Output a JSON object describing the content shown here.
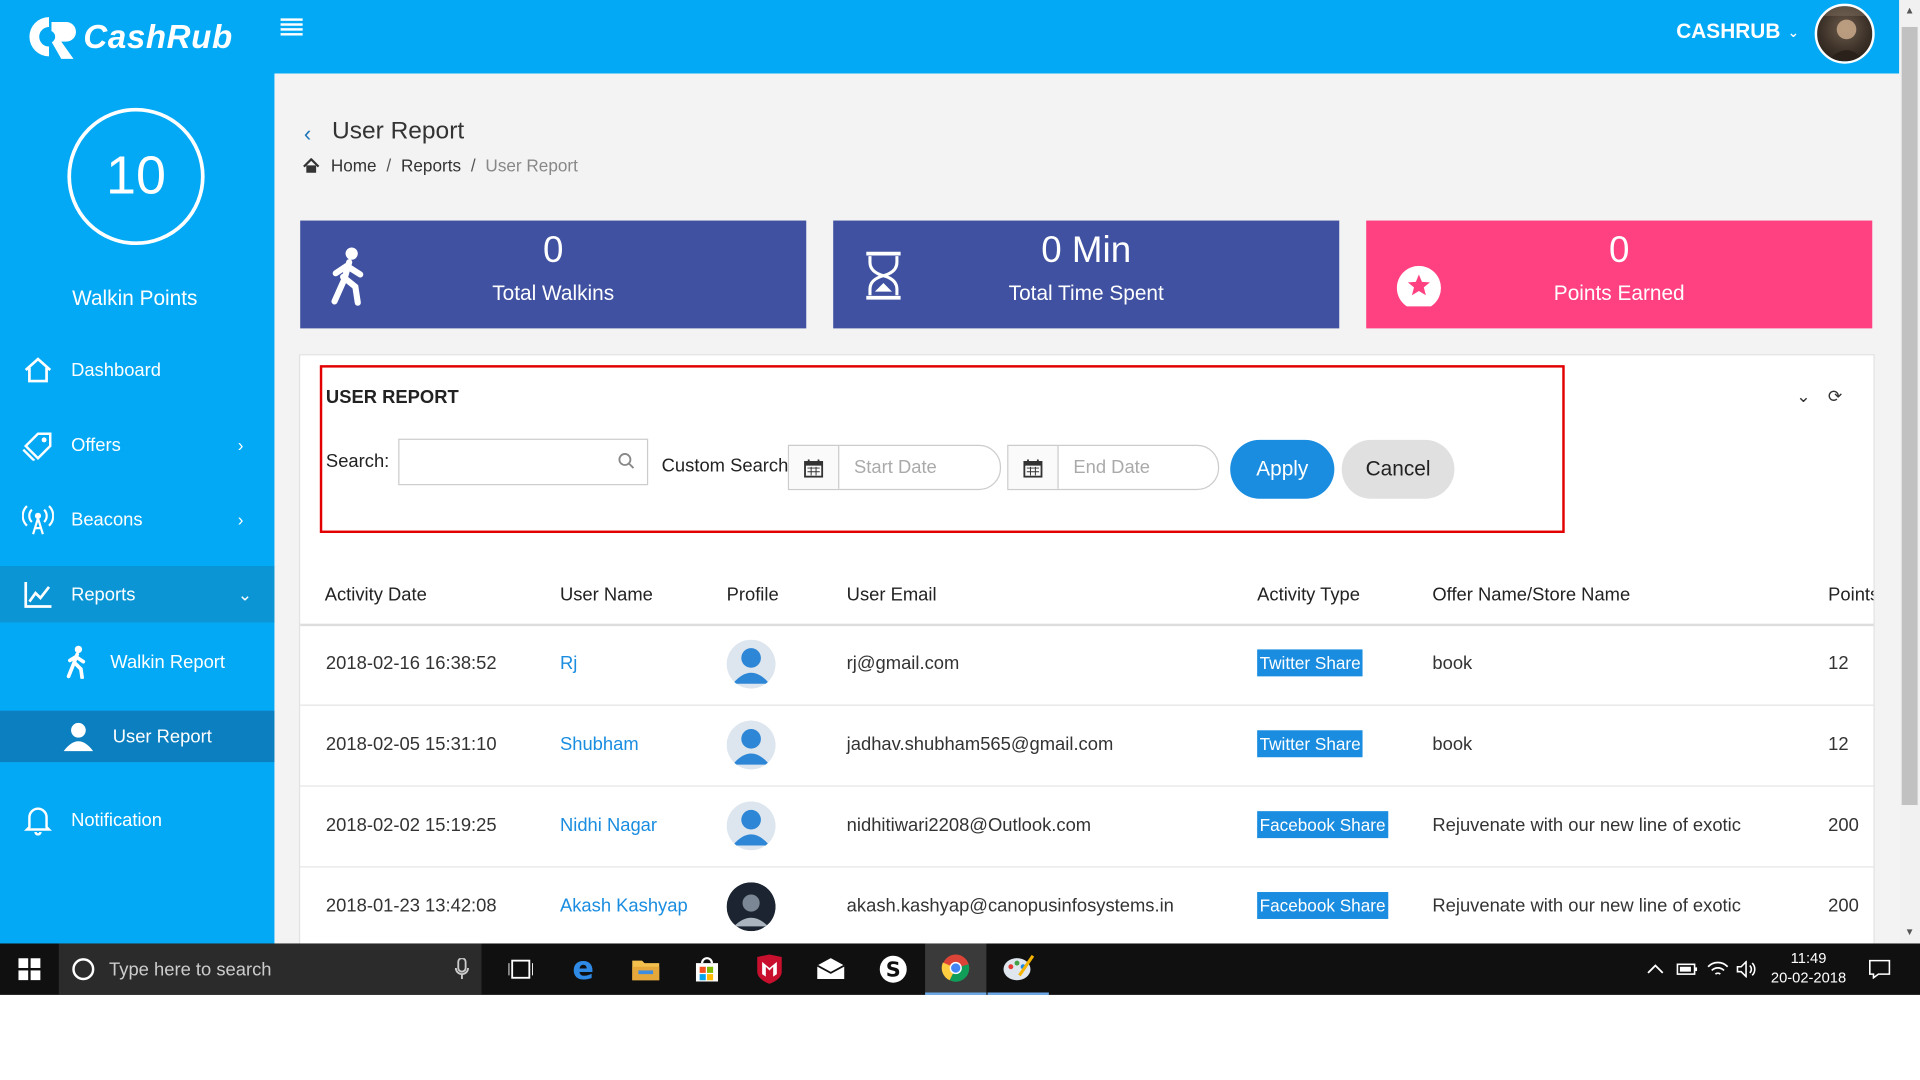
{
  "app": {
    "brand": "CashRub",
    "user_label": "CASHRUB"
  },
  "sidebar": {
    "points_value": "10",
    "points_label": "Walkin Points",
    "items": [
      {
        "label": "Dashboard"
      },
      {
        "label": "Offers"
      },
      {
        "label": "Beacons"
      },
      {
        "label": "Reports"
      },
      {
        "label": "Walkin Report"
      },
      {
        "label": "User Report"
      },
      {
        "label": "Notification"
      }
    ]
  },
  "page": {
    "title": "User Report",
    "breadcrumb": [
      "Home",
      "Reports",
      "User Report"
    ]
  },
  "stats": [
    {
      "value": "0",
      "caption": "Total Walkins",
      "color": "#3f51a0"
    },
    {
      "value": "0 Min",
      "caption": "Total Time Spent",
      "color": "#3f51a0"
    },
    {
      "value": "0",
      "caption": "Points Earned",
      "color": "#ff4081"
    }
  ],
  "filters": {
    "panel_title": "USER REPORT",
    "search_label": "Search:",
    "search_value": "",
    "custom_label": "Custom Search:",
    "start_placeholder": "Start Date",
    "end_placeholder": "End Date",
    "apply_label": "Apply",
    "cancel_label": "Cancel"
  },
  "table": {
    "columns": [
      "Activity Date",
      "User Name",
      "Profile",
      "User Email",
      "Activity Type",
      "Offer Name/Store Name",
      "Points"
    ],
    "rows": [
      {
        "date": "2018-02-16 16:38:52",
        "name": "Rj",
        "email": "rj@gmail.com",
        "activity": "Twitter Share",
        "offer": "book",
        "points": "12",
        "avatar": "default"
      },
      {
        "date": "2018-02-05 15:31:10",
        "name": "Shubham",
        "email": "jadhav.shubham565@gmail.com",
        "activity": "Twitter Share",
        "offer": "book",
        "points": "12",
        "avatar": "default"
      },
      {
        "date": "2018-02-02 15:19:25",
        "name": "Nidhi Nagar",
        "email": "nidhitiwari2208@Outlook.com",
        "activity": "Facebook Share",
        "offer": "Rejuvenate with our new line of exotic",
        "points": "200",
        "avatar": "default"
      },
      {
        "date": "2018-01-23 13:42:08",
        "name": "Akash Kashyap",
        "email": "akash.kashyap@canopusinfosystems.in",
        "activity": "Facebook Share",
        "offer": "Rejuvenate with our new line of exotic",
        "points": "200",
        "avatar": "photo"
      }
    ]
  },
  "taskbar": {
    "search_placeholder": "Type here to search",
    "time": "11:49",
    "date": "20-02-2018"
  },
  "colors": {
    "primary": "#03a9f4",
    "accent_blue": "#1a8de0",
    "card_blue": "#3f51a0",
    "card_pink": "#ff4081",
    "highlight": "#e30000"
  }
}
